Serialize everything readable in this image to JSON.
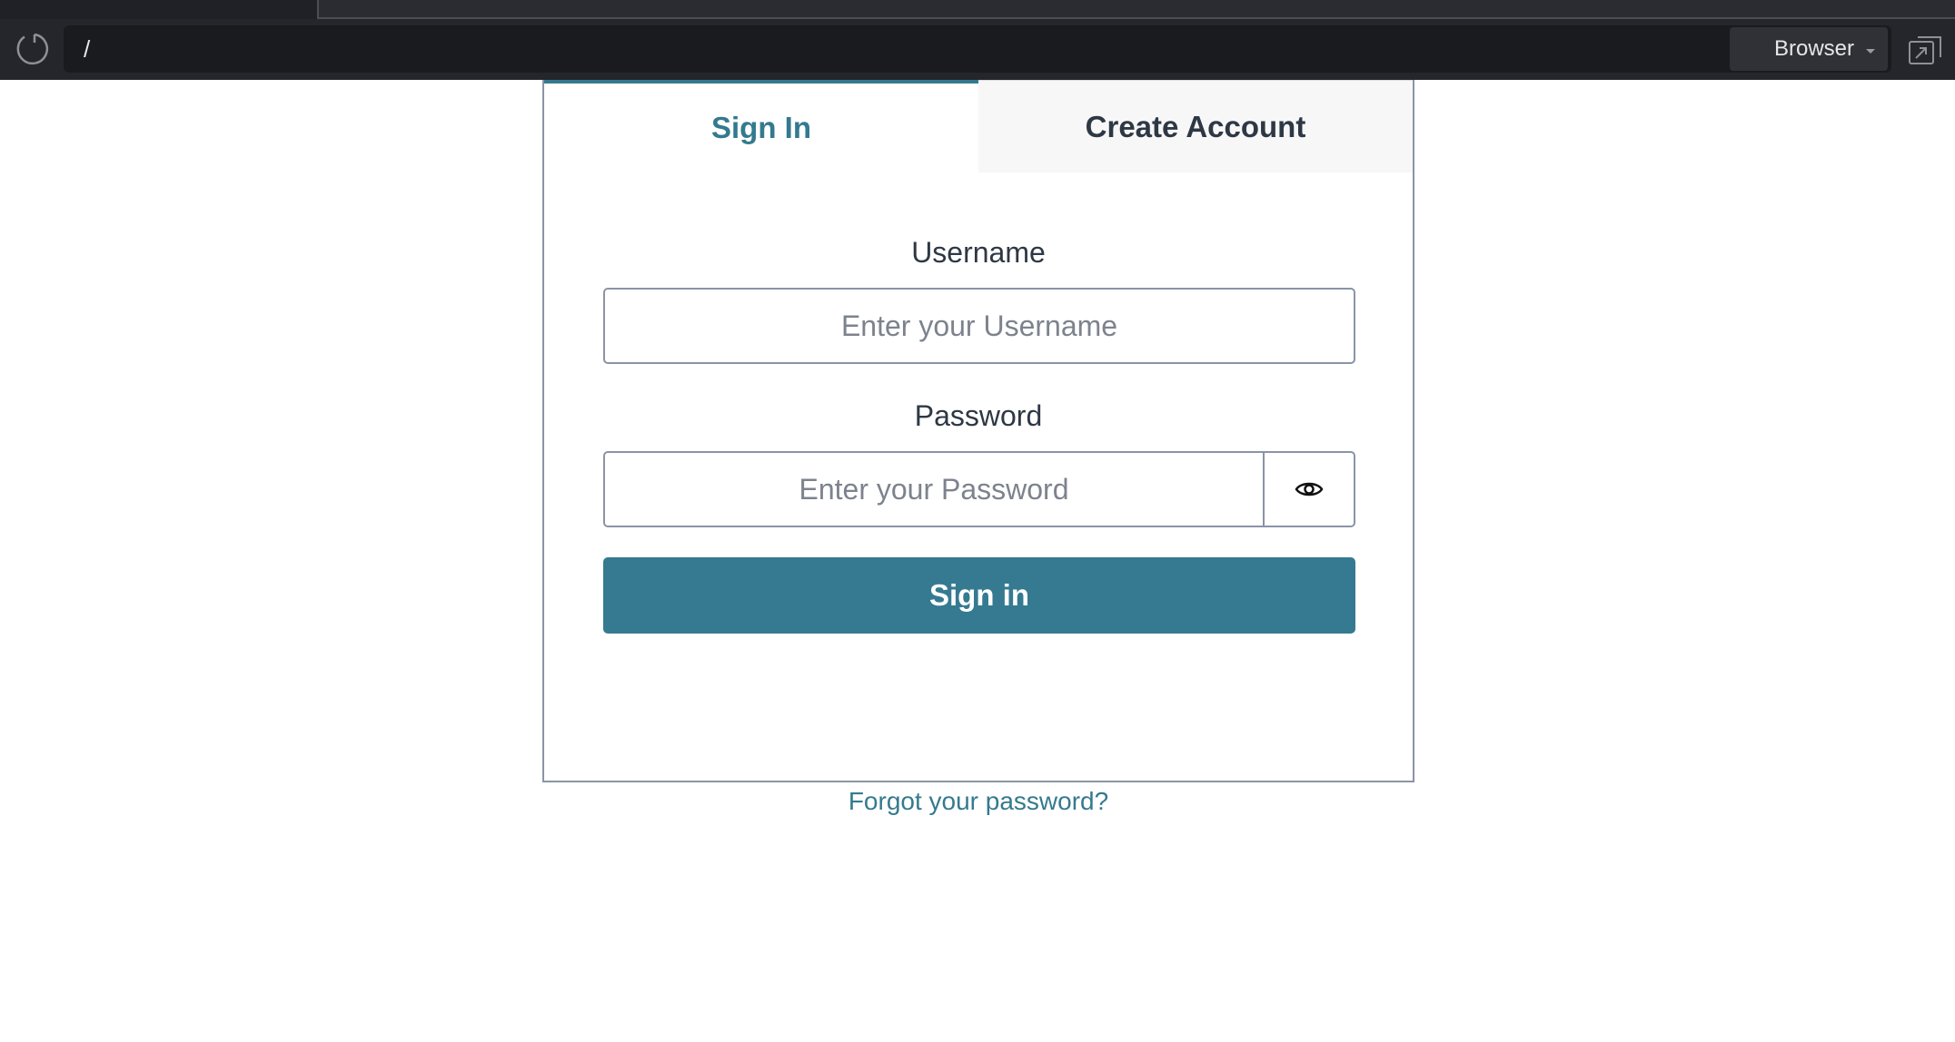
{
  "browser": {
    "url": "/",
    "mode_select": "Browser"
  },
  "auth": {
    "tabs": [
      {
        "label": "Sign In",
        "active": true
      },
      {
        "label": "Create Account",
        "active": false
      }
    ],
    "username_label": "Username",
    "username_placeholder": "Enter your Username",
    "password_label": "Password",
    "password_placeholder": "Enter your Password",
    "submit_label": "Sign in",
    "forgot_link": "Forgot your password?"
  },
  "colors": {
    "accent": "#357a91",
    "text": "#2e3845",
    "border": "#8a94a6",
    "chrome_bg": "#24262b"
  },
  "icons": {
    "reload": "reload-icon",
    "password_toggle": "eye-icon",
    "popout": "popout-icon"
  }
}
